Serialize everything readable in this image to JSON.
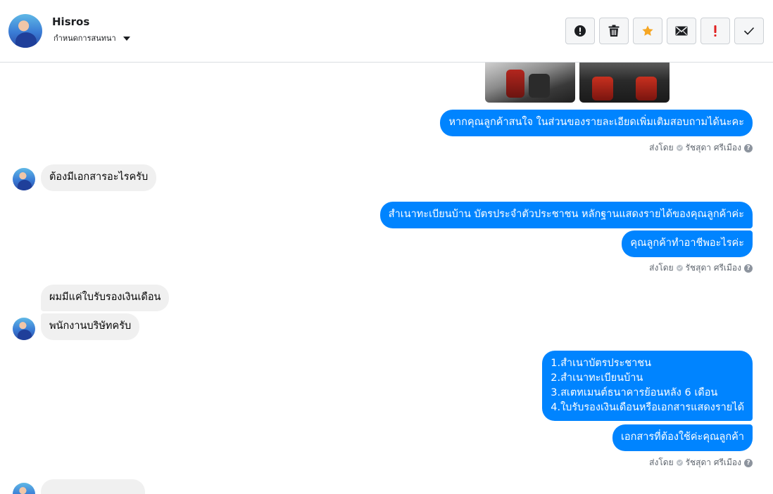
{
  "header": {
    "contact_name": "Hisros",
    "assign_label": "กำหนดการสนทนา"
  },
  "toolbar": {
    "buttons": [
      {
        "name": "report-spam",
        "icon": "alert-circle-icon"
      },
      {
        "name": "delete",
        "icon": "trash-icon"
      },
      {
        "name": "star",
        "icon": "star-icon",
        "color": "#f5a623"
      },
      {
        "name": "mark-unread",
        "icon": "envelope-icon"
      },
      {
        "name": "important",
        "icon": "exclamation-icon",
        "color": "#e02020"
      },
      {
        "name": "done",
        "icon": "checkmark-icon"
      }
    ]
  },
  "messages": {
    "m1": "หากคุณลูกค้าสนใจ ในส่วนของรายละเอียดเพิ่มเติมสอบถามได้นะคะ",
    "m2": "ต้องมีเอกสารอะไรครับ",
    "m3": "สำเนาทะเบียนบ้าน บัตรประจำตัวประชาชน หลักฐานแสดงรายได้ของคุณลูกค้าค่ะ",
    "m4": "คุณลูกค้าทำอาชีพอะไรค่ะ",
    "m5": "ผมมีแค่ใบรับรองเงินเดือน",
    "m6": "พนักงานบริษัทครับ",
    "m7": [
      "1.สำเนาบัตรประชาชน",
      "2.สำเนาทะเบียนบ้าน",
      "3.สเตทเมนต์ธนาคารย้อนหลัง 6 เดือน",
      "4.ใบรับรองเงินเดือนหรือเอกสารแสดงรายได้"
    ],
    "m8": "เอกสารที่ต้องใช้ค่ะคุณลูกค้า"
  },
  "sent_by": {
    "prefix": "ส่งโดย",
    "agent": "รัชสุดา ศรีเมือง",
    "help": "?"
  },
  "colors": {
    "outgoing": "#0084ff",
    "incoming": "#f0f0f0"
  }
}
